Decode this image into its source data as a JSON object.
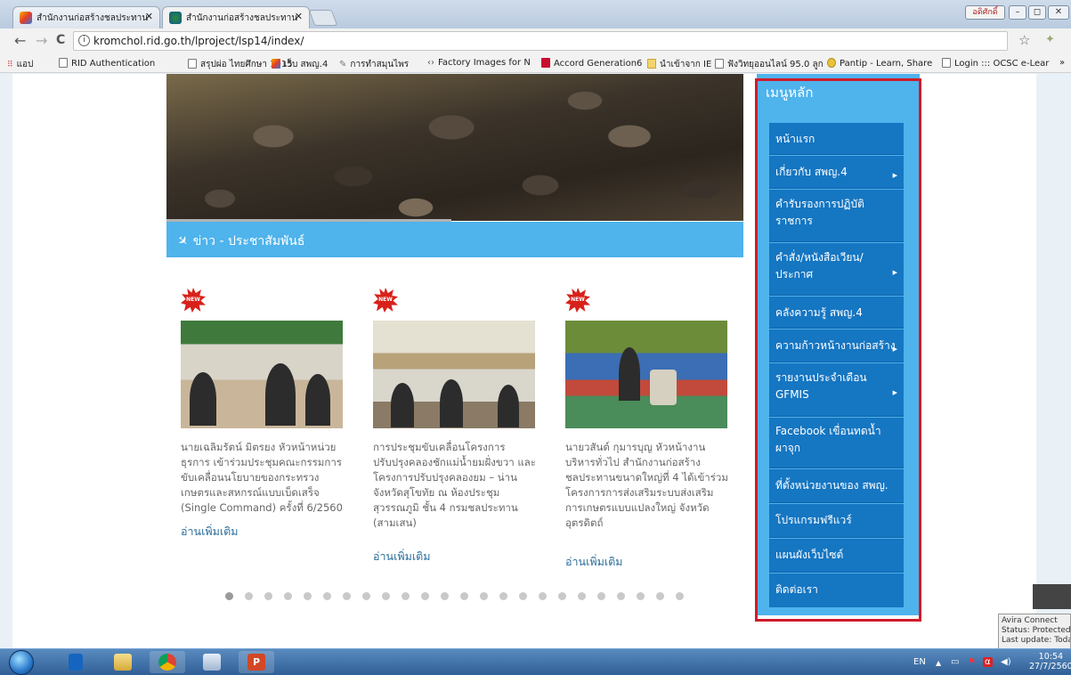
{
  "browser": {
    "tabs": [
      {
        "title": "สำนักงานก่อสร้างชลประทาน",
        "active": false
      },
      {
        "title": "สำนักงานก่อสร้างชลประทาน",
        "active": true
      }
    ],
    "user_button_label": "อดิศักดิ์",
    "window_controls": [
      "–",
      "◻",
      "✕"
    ],
    "url": "kromchol.rid.go.th/lproject/lsp14/index/",
    "back_icon": "←",
    "forward_icon": "→",
    "reload_icon": "C",
    "info_icon": "i",
    "star_icon": "☆",
    "more_bookmarks": "»",
    "bookmarks": [
      {
        "label": "แอป",
        "icon": "apps-icon"
      },
      {
        "label": "RID Authentication",
        "icon": "page-icon"
      },
      {
        "label": "สรุปผ่อ ไทยศึกษา 1015",
        "icon": "page-icon"
      },
      {
        "label": "เว็บ สพญ.4",
        "icon": "joomla-icon"
      },
      {
        "label": "การทำสมุนไพร",
        "icon": "pen-icon"
      },
      {
        "label": "Factory Images for N",
        "icon": "code-icon"
      },
      {
        "label": "Accord Generation6",
        "icon": "honda-icon"
      },
      {
        "label": "นำเข้าจาก IE",
        "icon": "folder-icon"
      },
      {
        "label": "ฟังวิทยุออนไลน์ 95.0 ลูก",
        "icon": "page-icon"
      },
      {
        "label": "Pantip - Learn, Share",
        "icon": "pantip-icon"
      },
      {
        "label": "Login ::: OCSC e-Lear",
        "icon": "page-icon"
      }
    ]
  },
  "site": {
    "news_header": "ข่าว - ประชาสัมพันธ์",
    "new_badge": "NEW",
    "news": [
      {
        "text": "นายเฉลิมรัตน์ มิตรยง หัวหน้าหน่วยธุรการ เข้าร่วมประชุมคณะกรรมการขับเคลื่อนนโยบายของกระทรวงเกษตรและสหกรณ์แบบเบ็ดเสร็จ (Single Command) ครั้งที่ 6/2560",
        "more": "อ่านเพิ่มเติม"
      },
      {
        "text": "การประชุมขับเคลื่อนโครงการปรับปรุงคลองชักแม่น้ำยมฝั่งขวา และ โครงการปรับปรุงคลองยม – น่าน จังหวัดสุโขทัย ณ ห้องประชุมสุวรรณภูมิ ชั้น 4 กรมชลประทาน (สามเสน)",
        "more": "อ่านเพิ่มเติม"
      },
      {
        "text": "นายวสันต์ กุมารบุญ หัวหน้างานบริหารทั่วไป สำนักงานก่อสร้างชลประทานขนาดใหญ่ที่ 4 ได้เข้าร่วมโครงการการส่งเสริมระบบส่งเสริมการเกษตรแบบแปลงใหญ่ จังหวัดอุตรดิตถ์",
        "more": "อ่านเพิ่มเติม"
      }
    ],
    "carousel": {
      "pages": 24,
      "active": 1
    },
    "menu": {
      "title": "เมนูหลัก",
      "items": [
        {
          "label": "หน้าแรก",
          "submenu": false
        },
        {
          "label": "เกี่ยวกับ สพญ.4",
          "submenu": true
        },
        {
          "label": "คำรับรองการปฏิบัติราชการ",
          "submenu": false
        },
        {
          "label": "คำสั่ง/หนังสือเวียน/ประกาศ",
          "submenu": true
        },
        {
          "label": "คลังความรู้ สพญ.4",
          "submenu": false
        },
        {
          "label": "ความก้าวหน้างานก่อสร้าง",
          "submenu": true
        },
        {
          "label": "รายงานประจำเดือน GFMIS",
          "submenu": true
        },
        {
          "label": "Facebook เขื่อนทดน้ำผาจุก",
          "submenu": false
        },
        {
          "label": "ที่ตั้งหน่วยงานของ สพญ.",
          "submenu": false
        },
        {
          "label": "โปรแกรมฟรีแวร์",
          "submenu": false
        },
        {
          "label": "แผนผังเว็บไซต์",
          "submenu": false
        },
        {
          "label": "ติดต่อเรา",
          "submenu": false
        }
      ]
    },
    "colors": {
      "menu_bg": "#4fb3ec",
      "menu_item": "#1576c2",
      "highlight_box": "#d01b2a"
    }
  },
  "avira": {
    "line1": "Avira Connect",
    "line2": "Status: Protected",
    "line3": "Last update: Toda"
  },
  "taskbar": {
    "apps": [
      "outlook-icon",
      "explorer-icon",
      "chrome-icon",
      "notes-icon",
      "powerpoint-icon"
    ],
    "lang": "EN",
    "tray_expand": "▲",
    "time": "10:54",
    "date": "27/7/2560"
  }
}
